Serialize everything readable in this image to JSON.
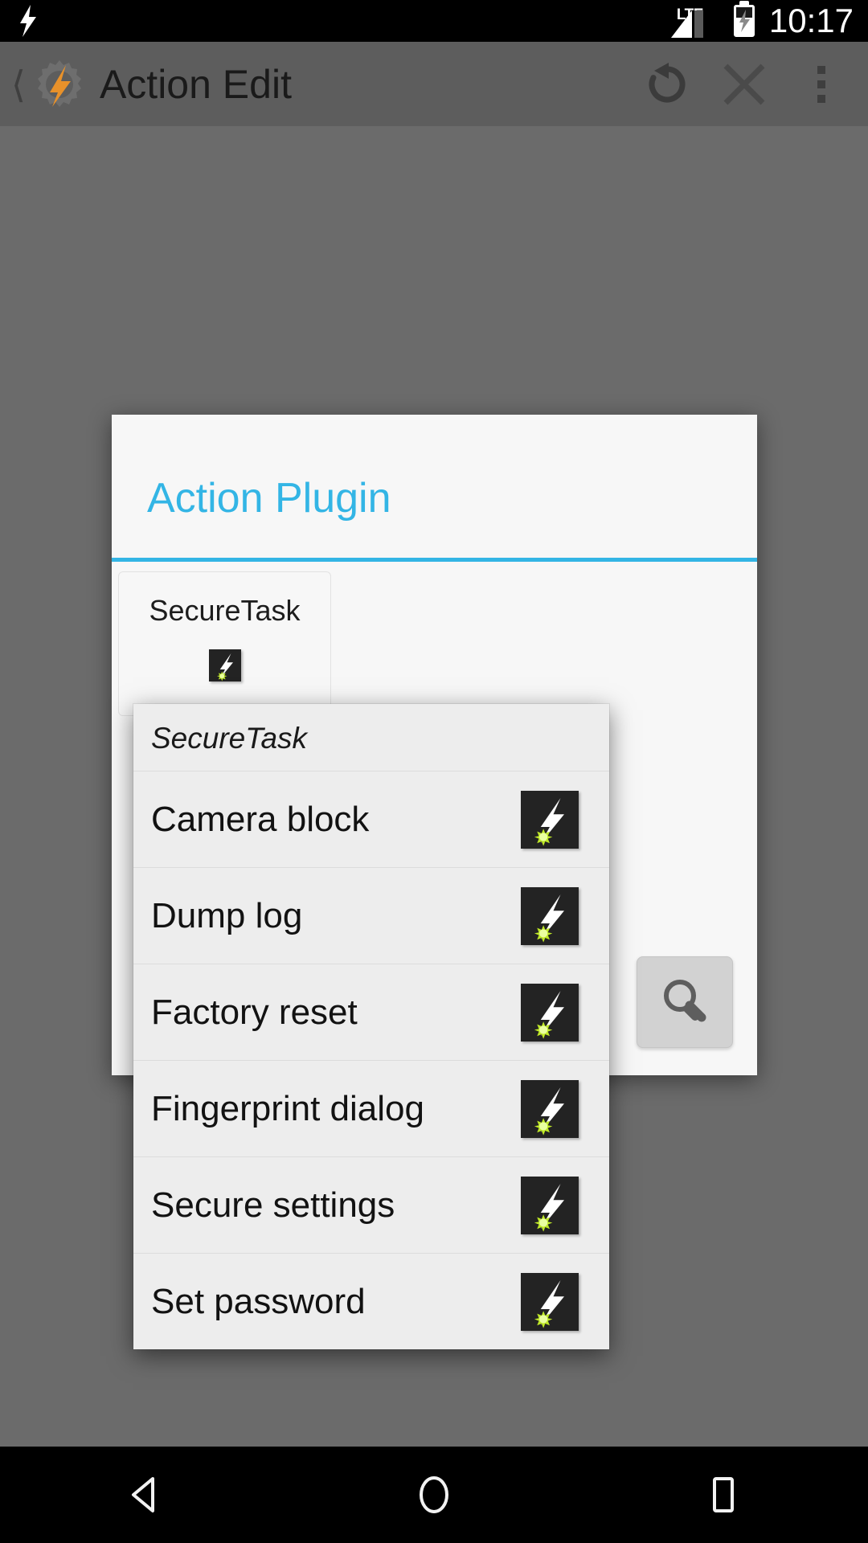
{
  "status_bar": {
    "notification_icon": "bolt-icon",
    "network_type": "LTE",
    "signal_icon": "signal-bars-icon",
    "battery_icon": "battery-charging-icon",
    "clock": "10:17"
  },
  "action_bar": {
    "back_icon": "back-chevron-icon",
    "app_icon": "tasker-gear-bolt-icon",
    "title": "Action Edit",
    "undo_icon": "undo-rotate-icon",
    "close_icon": "close-x-icon",
    "overflow_icon": "overflow-menu-icon"
  },
  "dialog": {
    "title": "Action Plugin",
    "accent_color": "#33b5e5",
    "background_color": "#f7f7f7",
    "plugins": [
      {
        "label": "SecureTask",
        "icon": "securetask-bolt-icon"
      }
    ],
    "search_button": {
      "icon": "search-magnifier-icon",
      "label": ""
    }
  },
  "popup_menu": {
    "header": "SecureTask",
    "items": [
      {
        "label": "Camera block",
        "icon": "securetask-bolt-icon"
      },
      {
        "label": "Dump log",
        "icon": "securetask-bolt-icon"
      },
      {
        "label": "Factory reset",
        "icon": "securetask-bolt-icon"
      },
      {
        "label": "Fingerprint dialog",
        "icon": "securetask-bolt-icon"
      },
      {
        "label": "Secure settings",
        "icon": "securetask-bolt-icon"
      },
      {
        "label": "Set password",
        "icon": "securetask-bolt-icon"
      }
    ]
  },
  "nav_bar": {
    "back_icon": "nav-back-triangle-icon",
    "home_icon": "nav-home-circle-icon",
    "recents_icon": "nav-recents-square-icon"
  },
  "colors": {
    "accent": "#33b5e5",
    "icon_dark": "#232323",
    "icon_bolt": "#ffffff",
    "icon_burst": "#bfe827",
    "scrim": "#6b6b6b",
    "action_bar": "#5d5d5d"
  }
}
